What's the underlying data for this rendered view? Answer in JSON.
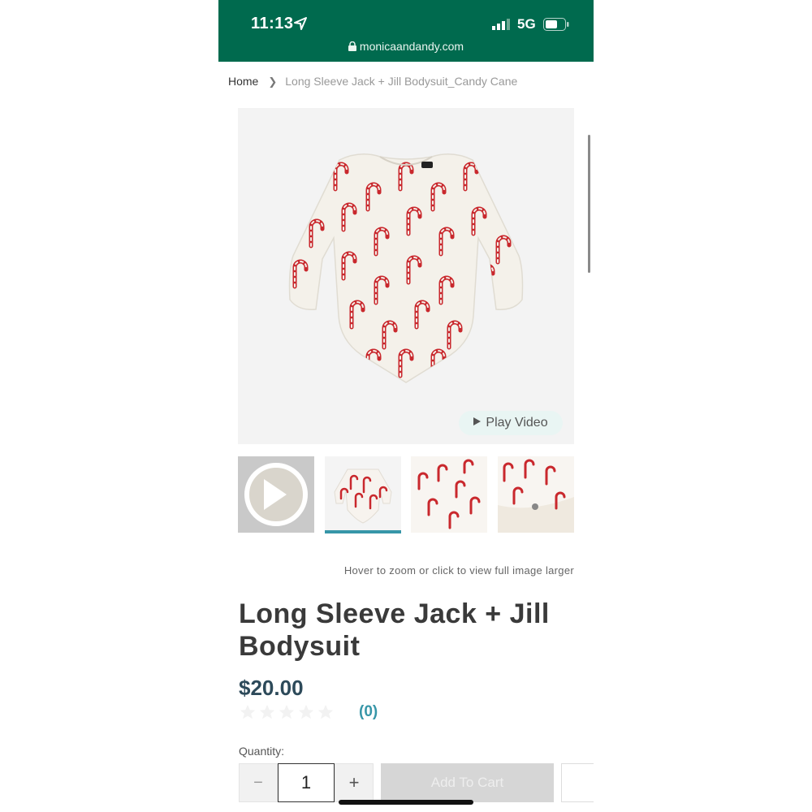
{
  "status_bar": {
    "time": "11:13",
    "network": "5G",
    "url": "monicaandandy.com",
    "icons": [
      "location-arrow-icon",
      "cell-signal-icon",
      "battery-icon",
      "lock-icon"
    ]
  },
  "breadcrumb": {
    "home": "Home",
    "current": "Long Sleeve Jack + Jill Bodysuit_Candy Cane"
  },
  "gallery": {
    "play_video_label": "Play Video",
    "zoom_hint": "Hover to zoom or click to view full image larger",
    "active_thumbnail": 1,
    "colors": {
      "print_red": "#c9282d",
      "garment": "#f4f1ea",
      "active_bar": "#3796a8"
    }
  },
  "product": {
    "title": "Long Sleeve Jack + Jill Bodysuit",
    "price": "$20.00",
    "rating": 0,
    "review_count": "(0)"
  },
  "purchase": {
    "quantity_label": "Quantity:",
    "minus": "−",
    "plus": "+",
    "quantity_value": "1",
    "add_to_cart": "Add To Cart"
  },
  "theme": {
    "status_bar_bg": "#006a4e",
    "price_color": "#2d4a5a",
    "accent": "#3796a8"
  }
}
